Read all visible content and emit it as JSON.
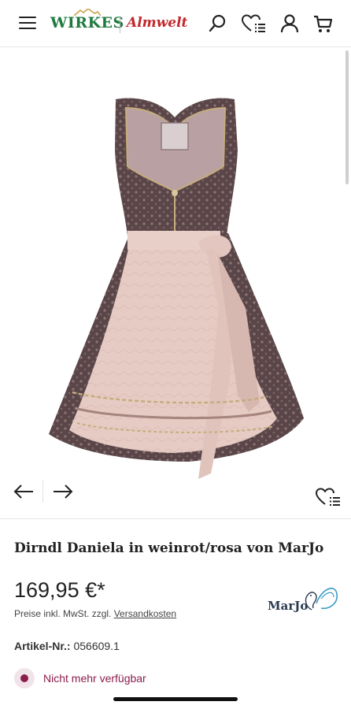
{
  "header": {
    "logo_primary": "WIRKES",
    "logo_secondary": "Almwelt",
    "menu_icon": "hamburger-menu-icon",
    "search_icon": "search-icon",
    "wishlist_icon": "heart-list-icon",
    "account_icon": "user-icon",
    "cart_icon": "cart-icon"
  },
  "gallery": {
    "prev_icon": "arrow-left-icon",
    "next_icon": "arrow-right-icon",
    "wishlist_icon": "heart-list-icon"
  },
  "product": {
    "title": "Dirndl Daniela in weinrot/rosa von MarJo",
    "price": "169,95 €*",
    "tax_prefix": "Preise inkl. MwSt. zzgl. ",
    "tax_link": "Versandkosten",
    "brand": "MarJo",
    "article_label": "Artikel-Nr.:",
    "article_number": "056609.1",
    "availability": "Nicht mehr verfügbar"
  },
  "colors": {
    "brand_green": "#1f7a3e",
    "brand_red": "#c0282d",
    "availability": "#8b1d4a"
  }
}
